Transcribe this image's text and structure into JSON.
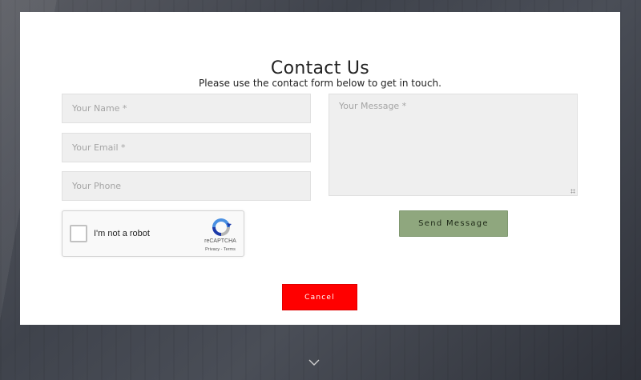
{
  "form": {
    "title": "Contact Us",
    "subtitle": "Please use the contact form below to get in touch.",
    "name_placeholder": "Your Name *",
    "email_placeholder": "Your Email *",
    "phone_placeholder": "Your Phone",
    "message_placeholder": "Your Message *",
    "send_label": "Send Message",
    "cancel_label": "Cancel"
  },
  "recaptcha": {
    "label": "I'm not a robot",
    "brand": "reCAPTCHA",
    "terms": "Privacy - Terms",
    "logo_icon": "recaptcha-logo-icon"
  },
  "page": {
    "scroll_icon": "chevron-down-icon"
  },
  "colors": {
    "send_button": "#8fa77e",
    "cancel_button": "#ff0000",
    "field_bg": "#efefef"
  }
}
